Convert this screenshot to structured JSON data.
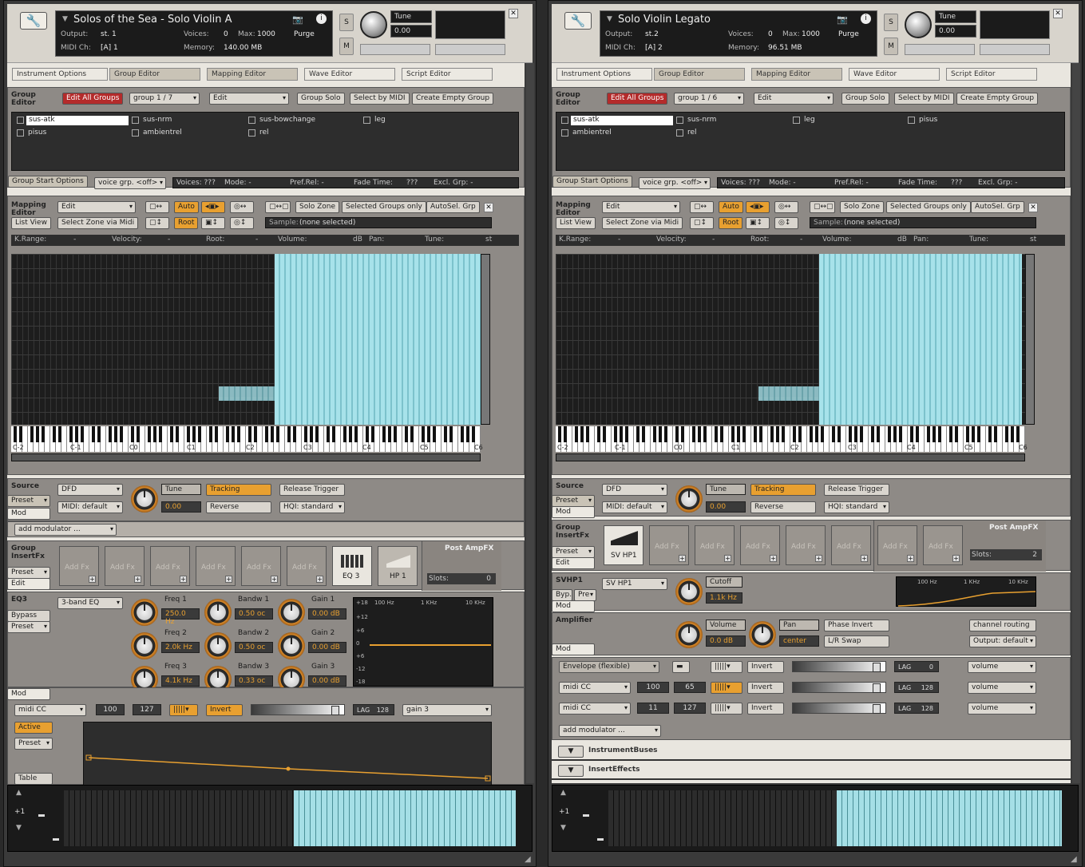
{
  "left": {
    "title": "Solos of the Sea - Solo Violin A",
    "output_label": "Output:",
    "output_value": "st. 1",
    "voices_label": "Voices:",
    "voices_value": "0",
    "max_label": "Max:",
    "max_value": "1000",
    "midi_label": "MIDI Ch:",
    "midi_value": "[A]  1",
    "memory_label": "Memory:",
    "memory_value": "140.00 MB",
    "purge": "Purge",
    "tune_label": "Tune",
    "tune_value": "0.00",
    "s_btn": "S",
    "m_btn": "M",
    "tabs": [
      "Instrument Options",
      "Group Editor",
      "Mapping Editor",
      "Wave Editor",
      "Script Editor"
    ],
    "group_editor": {
      "label": "Group Editor",
      "edit_all": "Edit All Groups",
      "group_sel": "group 1 / 7",
      "edit": "Edit",
      "group_solo": "Group Solo",
      "select_by_midi": "Select by MIDI",
      "create_empty": "Create Empty Group",
      "groups": [
        "sus-atk",
        "sus-nrm",
        "sus-bowchange",
        "leg",
        "pisus",
        "ambientrel",
        "rel"
      ],
      "gso": "Group Start Options",
      "voice_grp": "voice grp. <off>",
      "voices": "Voices: ???",
      "mode": "Mode: -",
      "pref_rel": "Pref.Rel: -",
      "fade": "Fade Time:",
      "fade_val": "???",
      "excl": "Excl. Grp: -"
    },
    "mapping": {
      "label": "Mapping Editor",
      "edit": "Edit",
      "auto": "Auto",
      "root": "Root",
      "list_view": "List View",
      "select_zone": "Select Zone via Midi",
      "solo_zone": "Solo Zone",
      "sel_groups": "Selected Groups only",
      "autosel": "AutoSel. Grp",
      "sample_label": "Sample:",
      "sample_value": "(none selected)",
      "header": [
        "K.Range:",
        "-",
        "Velocity:",
        "-",
        "Root:",
        "-",
        "Volume:",
        "dB",
        "Pan:",
        "Tune:",
        "st"
      ],
      "octaves": [
        "C-2",
        "C-1",
        "C0",
        "C1",
        "C2",
        "C3",
        "C4",
        "C5",
        "C6"
      ]
    },
    "source": {
      "label": "Source",
      "mode": "DFD",
      "tune": "Tune",
      "tune_val": "0.00",
      "tracking": "Tracking",
      "release": "Release Trigger",
      "midi": "MIDI: default",
      "reverse": "Reverse",
      "hqi": "HQI: standard",
      "preset": "Preset",
      "mod": "Mod",
      "add_mod": "add modulator ..."
    },
    "insertfx": {
      "label": "Group InsertFx",
      "preset": "Preset",
      "edit": "Edit",
      "slot_text": "Add Fx",
      "eq3": "EQ 3",
      "hp1": "HP 1",
      "post": "Post AmpFX",
      "slots_label": "Slots:",
      "slots_val": "0"
    },
    "eq": {
      "label": "EQ3",
      "bypass": "Bypass",
      "preset": "Preset",
      "type": "3-band EQ",
      "freq1": "Freq 1",
      "freq1_val": "250.0 Hz",
      "freq2": "Freq 2",
      "freq2_val": "2.0k Hz",
      "freq3": "Freq 3",
      "freq3_val": "4.1k Hz",
      "bw1": "Bandw 1",
      "bw1_val": "0.50 oc",
      "bw2": "Bandw 2",
      "bw2_val": "0.50 oc",
      "bw3": "Bandw 3",
      "bw3_val": "0.33 oc",
      "gain1": "Gain 1",
      "gain1_val": "0.00 dB",
      "gain2": "Gain 2",
      "gain2_val": "0.00 dB",
      "gain3": "Gain 3",
      "gain3_val": "0.00 dB",
      "graph_y": [
        "+18",
        "+12",
        "+6",
        "0",
        "+6",
        "-12",
        "-18"
      ],
      "graph_x": [
        "100 Hz",
        "1 KHz",
        "10 KHz"
      ]
    },
    "mod_row": {
      "mod_tab": "Mod",
      "source": "midi CC",
      "v1": "100",
      "v2": "127",
      "invert": "Invert",
      "lag_label": "LAG",
      "lag": "128",
      "target": "gain 3",
      "active": "Active",
      "preset": "Preset",
      "table": "Table"
    },
    "bottom": {
      "octave": "+1"
    }
  },
  "right": {
    "title": "Solo Violin Legato",
    "output_label": "Output:",
    "output_value": "st.2",
    "voices_label": "Voices:",
    "voices_value": "0",
    "max_label": "Max:",
    "max_value": "1000",
    "midi_label": "MIDI Ch:",
    "midi_value": "[A]  2",
    "memory_label": "Memory:",
    "memory_value": "96.51 MB",
    "purge": "Purge",
    "tune_label": "Tune",
    "tune_value": "0.00",
    "s_btn": "S",
    "m_btn": "M",
    "tabs": [
      "Instrument Options",
      "Group Editor",
      "Mapping Editor",
      "Wave Editor",
      "Script Editor"
    ],
    "group_editor": {
      "label": "Group Editor",
      "edit_all": "Edit All Groups",
      "group_sel": "group 1 / 6",
      "edit": "Edit",
      "group_solo": "Group Solo",
      "select_by_midi": "Select by MIDI",
      "create_empty": "Create Empty Group",
      "groups": [
        "sus-atk",
        "sus-nrm",
        "leg",
        "pisus",
        "ambientrel",
        "rel"
      ],
      "gso": "Group Start Options",
      "voice_grp": "voice grp. <off>",
      "voices": "Voices: ???",
      "mode": "Mode: -",
      "pref_rel": "Pref.Rel: -",
      "fade": "Fade Time:",
      "fade_val": "???",
      "excl": "Excl. Grp: -"
    },
    "mapping": {
      "label": "Mapping Editor",
      "edit": "Edit",
      "auto": "Auto",
      "root": "Root",
      "list_view": "List View",
      "select_zone": "Select Zone via Midi",
      "solo_zone": "Solo Zone",
      "sel_groups": "Selected Groups only",
      "autosel": "AutoSel. Grp",
      "sample_label": "Sample:",
      "sample_value": "(none selected)",
      "header": [
        "K.Range:",
        "-",
        "Velocity:",
        "-",
        "Root:",
        "-",
        "Volume:",
        "dB",
        "Pan:",
        "Tune:",
        "st"
      ],
      "octaves": [
        "C-2",
        "C-1",
        "C0",
        "C1",
        "C2",
        "C3",
        "C4",
        "C5",
        "C6"
      ]
    },
    "source": {
      "label": "Source",
      "mode": "DFD",
      "tune": "Tune",
      "tune_val": "0.00",
      "tracking": "Tracking",
      "release": "Release Trigger",
      "midi": "MIDI: default",
      "reverse": "Reverse",
      "hqi": "HQI: standard",
      "preset": "Preset",
      "mod": "Mod"
    },
    "insertfx": {
      "label": "Group InsertFx",
      "preset": "Preset",
      "edit": "Edit",
      "slot_text": "Add Fx",
      "svhp1": "SV HP1",
      "post": "Post AmpFX",
      "slots_label": "Slots:",
      "slots_val": "2"
    },
    "svhp": {
      "label": "SVHP1",
      "byp": "Byp.",
      "pre": "Pre",
      "mod": "Mod",
      "type": "SV HP1",
      "cutoff": "Cutoff",
      "cutoff_val": "1.1k Hz",
      "graph_x": [
        "100 Hz",
        "1 KHz",
        "10 KHz"
      ]
    },
    "amp": {
      "label": "Amplifier",
      "volume": "Volume",
      "volume_val": "0.0 dB",
      "pan": "Pan",
      "pan_val": "center",
      "phase": "Phase Invert",
      "lr": "L/R Swap",
      "routing": "channel routing",
      "output": "Output: default",
      "mod": "Mod"
    },
    "mods": [
      {
        "source": "Envelope (flexible)",
        "v1": "",
        "v2": "",
        "invert": "Invert",
        "lag": "0",
        "target": "volume"
      },
      {
        "source": "midi CC",
        "v1": "100",
        "v2": "65",
        "invert": "Invert",
        "lag": "128",
        "target": "volume"
      },
      {
        "source": "midi CC",
        "v1": "11",
        "v2": "127",
        "invert": "Invert",
        "lag": "128",
        "target": "volume"
      }
    ],
    "lag_label": "LAG",
    "add_mod": "add modulator ...",
    "buses": "InstrumentBuses",
    "effects": "InsertEffects",
    "bottom": {
      "octave": "+1"
    }
  }
}
